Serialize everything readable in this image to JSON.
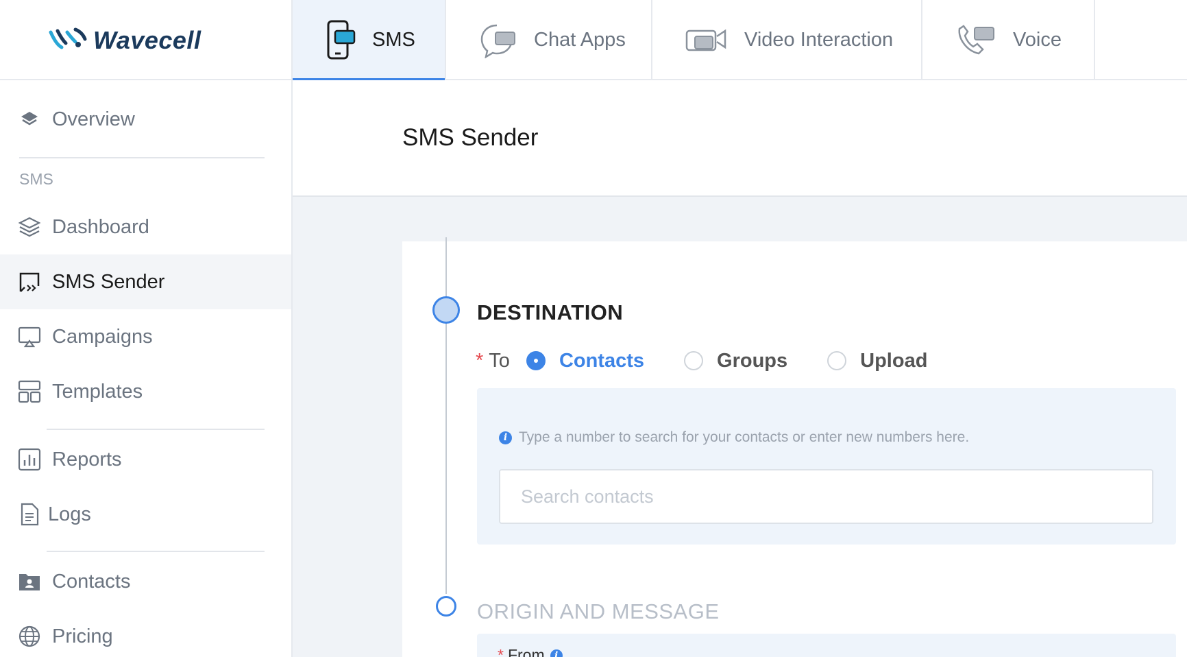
{
  "brand": {
    "name": "Wavecell",
    "accent": "#3d84e6",
    "dark": "#1b3a5c"
  },
  "top_tabs": [
    {
      "label": "SMS",
      "icon": "phone-chat-icon",
      "active": true
    },
    {
      "label": "Chat Apps",
      "icon": "chat-bubble-icon",
      "active": false
    },
    {
      "label": "Video Interaction",
      "icon": "video-camera-icon",
      "active": false
    },
    {
      "label": "Voice",
      "icon": "phone-handset-icon",
      "active": false
    }
  ],
  "sidebar": {
    "overview": "Overview",
    "section_sms": "SMS",
    "items": [
      {
        "label": "Dashboard",
        "icon": "layers-icon"
      },
      {
        "label": "SMS Sender",
        "icon": "sms-sender-icon",
        "active": true
      },
      {
        "label": "Campaigns",
        "icon": "campaign-screen-icon"
      },
      {
        "label": "Templates",
        "icon": "templates-grid-icon"
      },
      {
        "label": "Reports",
        "icon": "bar-chart-icon"
      },
      {
        "label": "Logs",
        "icon": "document-icon"
      },
      {
        "label": "Contacts",
        "icon": "contacts-folder-icon"
      },
      {
        "label": "Pricing",
        "icon": "globe-icon"
      }
    ]
  },
  "page": {
    "title": "SMS Sender",
    "destination": {
      "title": "DESTINATION",
      "required_mark": "*",
      "to_label": "To",
      "options": [
        {
          "label": "Contacts",
          "checked": true
        },
        {
          "label": "Groups",
          "checked": false
        },
        {
          "label": "Upload",
          "checked": false
        }
      ],
      "hint": "Type a number to search for your contacts or enter new numbers here.",
      "search_placeholder": "Search contacts"
    },
    "origin": {
      "title": "ORIGIN AND MESSAGE",
      "from_label": "From"
    }
  }
}
